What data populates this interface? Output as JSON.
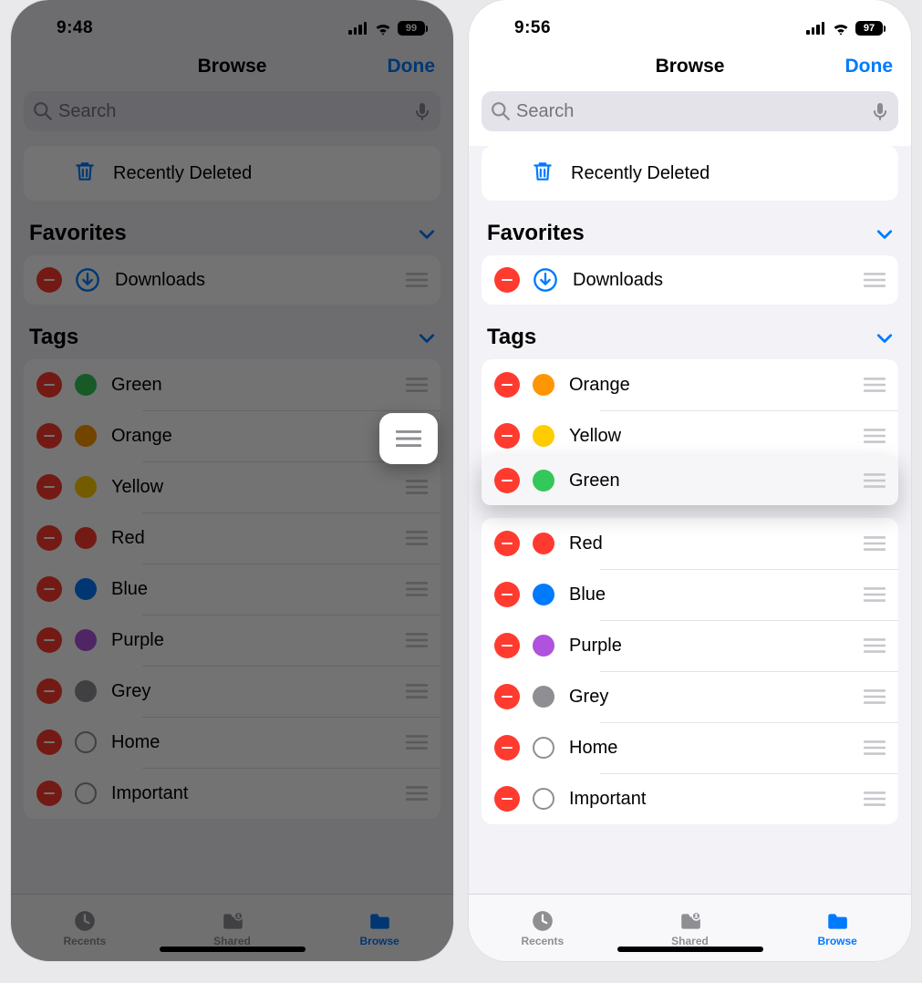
{
  "left": {
    "status": {
      "time": "9:48",
      "battery": "99"
    },
    "nav": {
      "title": "Browse",
      "done": "Done"
    },
    "search": {
      "placeholder": "Search"
    },
    "recently_deleted": "Recently Deleted",
    "favorites_header": "Favorites",
    "favorites": [
      {
        "label": "Downloads"
      }
    ],
    "tags_header": "Tags",
    "tags": [
      {
        "label": "Green",
        "color": "#34c759",
        "hollow": false
      },
      {
        "label": "Orange",
        "color": "#ff9500",
        "hollow": false
      },
      {
        "label": "Yellow",
        "color": "#ffcc00",
        "hollow": false
      },
      {
        "label": "Red",
        "color": "#ff3b30",
        "hollow": false
      },
      {
        "label": "Blue",
        "color": "#007aff",
        "hollow": false
      },
      {
        "label": "Purple",
        "color": "#af52de",
        "hollow": false
      },
      {
        "label": "Grey",
        "color": "#8e8e93",
        "hollow": false
      },
      {
        "label": "Home",
        "color": "",
        "hollow": true
      },
      {
        "label": "Important",
        "color": "",
        "hollow": true
      }
    ],
    "tabs": {
      "recents": "Recents",
      "shared": "Shared",
      "browse": "Browse"
    }
  },
  "right": {
    "status": {
      "time": "9:56",
      "battery": "97"
    },
    "nav": {
      "title": "Browse",
      "done": "Done"
    },
    "search": {
      "placeholder": "Search"
    },
    "recently_deleted": "Recently Deleted",
    "favorites_header": "Favorites",
    "favorites": [
      {
        "label": "Downloads"
      }
    ],
    "tags_header": "Tags",
    "tags_top": [
      {
        "label": "Orange",
        "color": "#ff9500"
      },
      {
        "label": "Yellow",
        "color": "#ffcc00"
      }
    ],
    "tag_lifted": {
      "label": "Green",
      "color": "#34c759"
    },
    "tags_bottom": [
      {
        "label": "Red",
        "color": "#ff3b30",
        "hollow": false
      },
      {
        "label": "Blue",
        "color": "#007aff",
        "hollow": false
      },
      {
        "label": "Purple",
        "color": "#af52de",
        "hollow": false
      },
      {
        "label": "Grey",
        "color": "#8e8e93",
        "hollow": false
      },
      {
        "label": "Home",
        "color": "",
        "hollow": true
      },
      {
        "label": "Important",
        "color": "",
        "hollow": true
      }
    ],
    "tabs": {
      "recents": "Recents",
      "shared": "Shared",
      "browse": "Browse"
    }
  }
}
